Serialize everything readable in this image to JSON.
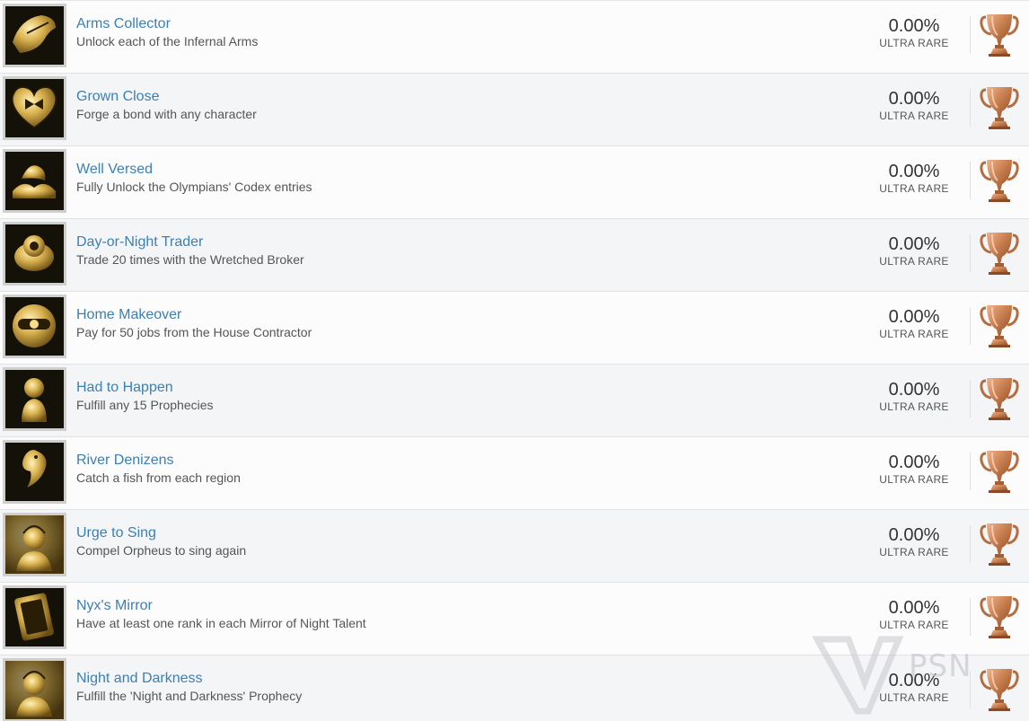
{
  "trophies": [
    {
      "title": "Arms Collector",
      "description": "Unlock each of the Infernal Arms",
      "percent": "0.00%",
      "rarity": "ULTRA RARE",
      "grade": "bronze",
      "icon": "infernal-arms-icon"
    },
    {
      "title": "Grown Close",
      "description": "Forge a bond with any character",
      "percent": "0.00%",
      "rarity": "ULTRA RARE",
      "grade": "bronze",
      "icon": "heart-bond-icon"
    },
    {
      "title": "Well Versed",
      "description": "Fully Unlock the Olympians' Codex entries",
      "percent": "0.00%",
      "rarity": "ULTRA RARE",
      "grade": "bronze",
      "icon": "olympians-codex-icon"
    },
    {
      "title": "Day-or-Night Trader",
      "description": "Trade 20 times with the Wretched Broker",
      "percent": "0.00%",
      "rarity": "ULTRA RARE",
      "grade": "bronze",
      "icon": "wretched-broker-icon"
    },
    {
      "title": "Home Makeover",
      "description": "Pay for 50 jobs from the House Contractor",
      "percent": "0.00%",
      "rarity": "ULTRA RARE",
      "grade": "bronze",
      "icon": "house-contractor-icon"
    },
    {
      "title": "Had to Happen",
      "description": "Fulfill any 15 Prophecies",
      "percent": "0.00%",
      "rarity": "ULTRA RARE",
      "grade": "bronze",
      "icon": "fates-statue-icon"
    },
    {
      "title": "River Denizens",
      "description": "Catch a fish from each region",
      "percent": "0.00%",
      "rarity": "ULTRA RARE",
      "grade": "bronze",
      "icon": "fish-icon"
    },
    {
      "title": "Urge to Sing",
      "description": "Compel Orpheus to sing again",
      "percent": "0.00%",
      "rarity": "ULTRA RARE",
      "grade": "bronze",
      "icon": "orpheus-portrait-icon"
    },
    {
      "title": "Nyx's Mirror",
      "description": "Have at least one rank in each Mirror of Night Talent",
      "percent": "0.00%",
      "rarity": "ULTRA RARE",
      "grade": "bronze",
      "icon": "mirror-of-night-icon"
    },
    {
      "title": "Night and Darkness",
      "description": "Fulfill the 'Night and Darkness' Prophecy",
      "percent": "0.00%",
      "rarity": "ULTRA RARE",
      "grade": "bronze",
      "icon": "nyx-portrait-icon"
    }
  ],
  "watermark": {
    "text": "PSN",
    "icon": "psnprofiles-watermark-icon"
  },
  "colors": {
    "title_link": "#3b80b4",
    "description": "#555555",
    "bronze": "#c47a4a",
    "row_odd": "#fcfcfd",
    "row_even": "#f4f5f7"
  }
}
